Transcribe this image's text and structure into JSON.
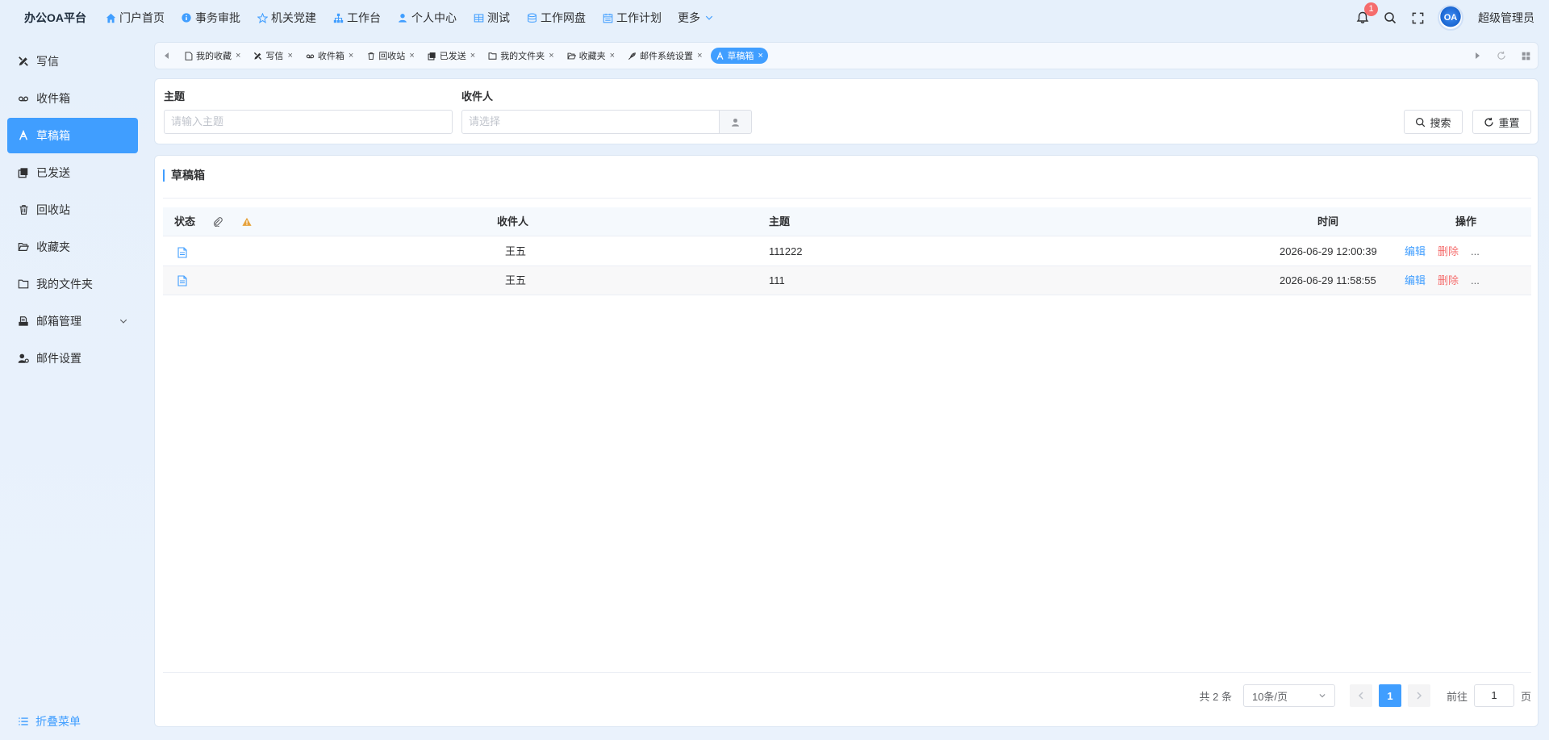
{
  "app": {
    "title": "办公OA平台"
  },
  "topnav": {
    "items": [
      {
        "label": "门户首页",
        "icon": "home-icon"
      },
      {
        "label": "事务审批",
        "icon": "info-icon"
      },
      {
        "label": "机关党建",
        "icon": "star-icon"
      },
      {
        "label": "工作台",
        "icon": "org-icon"
      },
      {
        "label": "个人中心",
        "icon": "user-icon"
      },
      {
        "label": "测试",
        "icon": "table-icon"
      },
      {
        "label": "工作网盘",
        "icon": "database-icon"
      },
      {
        "label": "工作计划",
        "icon": "calendar-icon"
      }
    ],
    "more_label": "更多",
    "notification_count": "1",
    "avatar_text": "OA",
    "username": "超级管理员"
  },
  "sidebar": {
    "items": [
      {
        "label": "写信",
        "icon": "pen-icon"
      },
      {
        "label": "收件箱",
        "icon": "inbox-icon"
      },
      {
        "label": "草稿箱",
        "icon": "draft-icon",
        "active": true
      },
      {
        "label": "已发送",
        "icon": "sent-icon"
      },
      {
        "label": "回收站",
        "icon": "trash-icon"
      },
      {
        "label": "收藏夹",
        "icon": "folder-open-icon"
      },
      {
        "label": "我的文件夹",
        "icon": "folder-icon"
      },
      {
        "label": "邮箱管理",
        "icon": "mailbox-icon"
      },
      {
        "label": "邮件设置",
        "icon": "user-settings-icon"
      }
    ],
    "collapse_label": "折叠菜单"
  },
  "tabs": {
    "items": [
      {
        "label": "我的收藏"
      },
      {
        "label": "写信"
      },
      {
        "label": "收件箱"
      },
      {
        "label": "回收站"
      },
      {
        "label": "已发送"
      },
      {
        "label": "我的文件夹"
      },
      {
        "label": "收藏夹"
      },
      {
        "label": "邮件系统设置"
      },
      {
        "label": "草稿箱",
        "active": true
      }
    ]
  },
  "search": {
    "subject_label": "主题",
    "subject_placeholder": "请输入主题",
    "recipient_label": "收件人",
    "recipient_placeholder": "请选择",
    "search_button": "搜索",
    "reset_button": "重置"
  },
  "table": {
    "title": "草稿箱",
    "headers": {
      "status": "状态",
      "recipient": "收件人",
      "subject": "主题",
      "time": "时间",
      "actions": "操作"
    },
    "rows": [
      {
        "recipient": "王五",
        "subject": "111222",
        "time": "2026-06-29 12:00:39"
      },
      {
        "recipient": "王五",
        "subject": "111",
        "time": "2026-06-29 11:58:55"
      }
    ],
    "edit_label": "编辑",
    "delete_label": "删除",
    "more_label": "..."
  },
  "pagination": {
    "total_text": "共 2 条",
    "page_size": "10条/页",
    "current_page": "1",
    "goto_prefix": "前往",
    "goto_value": "1",
    "goto_suffix": "页"
  },
  "colors": {
    "primary": "#409eff",
    "danger": "#f56c6c",
    "warning": "#e6a23c"
  }
}
